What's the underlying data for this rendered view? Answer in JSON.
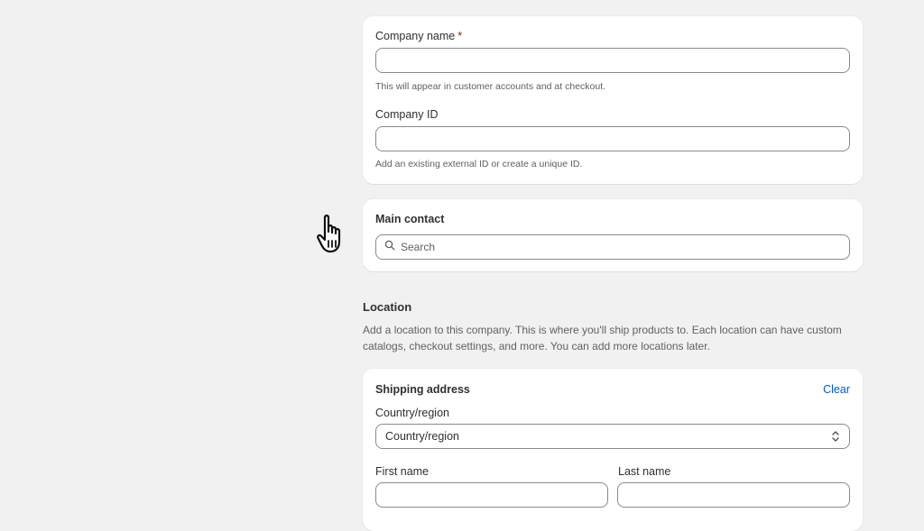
{
  "company": {
    "name_label": "Company name",
    "required_mark": "*",
    "name_value": "",
    "name_help": "This will appear in customer accounts and at checkout.",
    "id_label": "Company ID",
    "id_value": "",
    "id_help": "Add an existing external ID or create a unique ID."
  },
  "contact": {
    "heading": "Main contact",
    "search_placeholder": "Search",
    "search_icon": "search-icon"
  },
  "location": {
    "title": "Location",
    "description": "Add a location to this company. This is where you'll ship products to. Each location can have custom catalogs, checkout settings, and more. You can add more locations later."
  },
  "shipping": {
    "heading": "Shipping address",
    "clear_label": "Clear",
    "country_label": "Country/region",
    "country_value": "Country/region",
    "first_name_label": "First name",
    "last_name_label": "Last name",
    "first_name_value": "",
    "last_name_value": ""
  },
  "colors": {
    "background": "#f1f1f1",
    "card": "#ffffff",
    "link": "#005bd3",
    "required": "#8e1f0b"
  }
}
